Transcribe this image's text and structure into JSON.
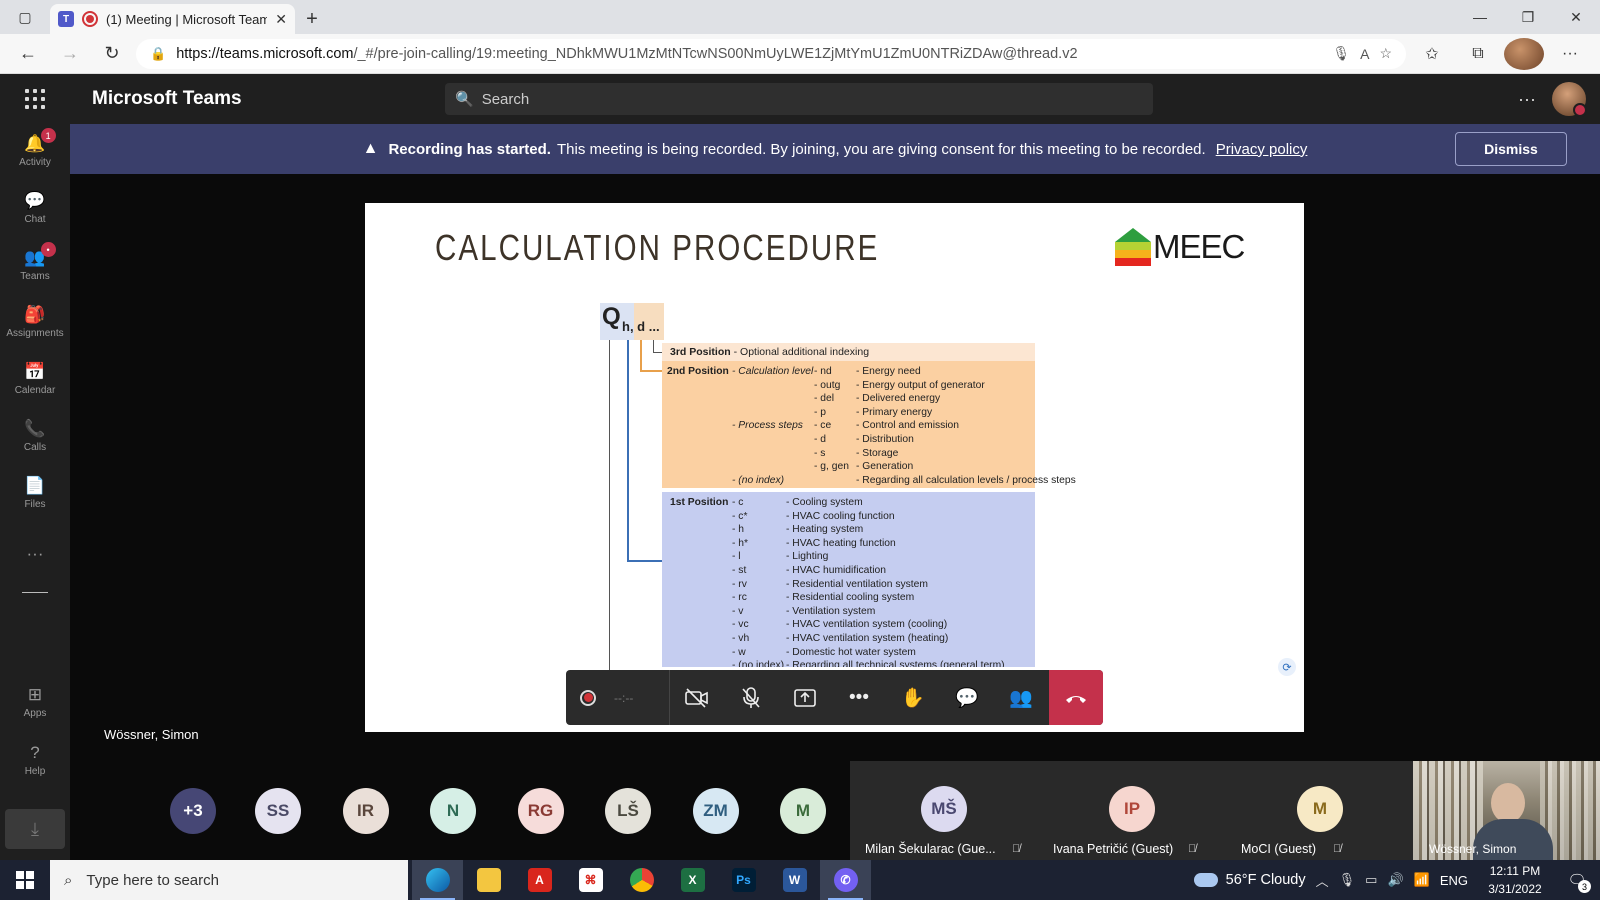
{
  "browser": {
    "tab_title": "(1) Meeting | Microsoft Teams",
    "tab_close": "✕",
    "new_tab": "+",
    "url_host": "https://teams.microsoft.com",
    "url_path": "/_#/pre-join-calling/19:meeting_NDhkMWU1MzMtNTcwNS00NmUyLWE1ZjMtYmU1ZmU0NTRiZDAw@thread.v2",
    "window_controls": [
      "—",
      "❐",
      "✕"
    ]
  },
  "teams": {
    "app_title": "Microsoft Teams",
    "search_placeholder": "Search",
    "more": "···"
  },
  "rail": {
    "items": [
      {
        "label": "Activity",
        "icon": "bell-icon",
        "glyph": "🔔",
        "badge": "1"
      },
      {
        "label": "Chat",
        "icon": "chat-icon",
        "glyph": "💬",
        "badge": ""
      },
      {
        "label": "Teams",
        "icon": "teams-icon",
        "glyph": "👥",
        "badge": "•"
      },
      {
        "label": "Assignments",
        "icon": "assignments-icon",
        "glyph": "🎒",
        "badge": ""
      },
      {
        "label": "Calendar",
        "icon": "calendar-icon",
        "glyph": "📅",
        "badge": ""
      },
      {
        "label": "Calls",
        "icon": "phone-icon",
        "glyph": "📞",
        "badge": ""
      },
      {
        "label": "Files",
        "icon": "file-icon",
        "glyph": "📄",
        "badge": ""
      }
    ],
    "more": "···",
    "apps_label": "Apps",
    "help_label": "Help"
  },
  "banner": {
    "bold": "Recording has started.",
    "text": "This meeting is being recorded. By joining, you are giving consent for this meeting to be recorded.",
    "link": "Privacy policy",
    "dismiss": "Dismiss"
  },
  "slide": {
    "title": "CALCULATION PROCEDURE",
    "logo_text": "MEEC",
    "q_symbol": "Q",
    "q_subscript": "h, d ...",
    "pos3_head": "3rd Position",
    "pos3_text": "- Optional additional indexing",
    "pos2_head": "2nd Position",
    "pos2_rows": [
      {
        "a": "- Calculation level",
        "b": "- nd",
        "c": "- Energy need"
      },
      {
        "a": "",
        "b": "- outg",
        "c": "- Energy output of generator"
      },
      {
        "a": "",
        "b": "- del",
        "c": "- Delivered energy"
      },
      {
        "a": "",
        "b": "- p",
        "c": "- Primary energy"
      },
      {
        "a": "- Process steps",
        "b": "- ce",
        "c": "- Control and emission"
      },
      {
        "a": "",
        "b": "- d",
        "c": "- Distribution"
      },
      {
        "a": "",
        "b": "- s",
        "c": "- Storage"
      },
      {
        "a": "",
        "b": "- g, gen",
        "c": "- Generation"
      },
      {
        "a": "- (no index)",
        "b": "",
        "c": "- Regarding all calculation levels / process steps"
      }
    ],
    "pos1_head": "1st Position",
    "pos1_rows": [
      {
        "b": "- c",
        "c": "- Cooling system"
      },
      {
        "b": "- c*",
        "c": "- HVAC cooling function"
      },
      {
        "b": "- h",
        "c": "- Heating system"
      },
      {
        "b": "- h*",
        "c": "- HVAC heating function"
      },
      {
        "b": "- l",
        "c": "- Lighting"
      },
      {
        "b": "- st",
        "c": "- HVAC humidification"
      },
      {
        "b": "- rv",
        "c": "- Residential ventilation system"
      },
      {
        "b": "- rc",
        "c": "- Residential cooling system"
      },
      {
        "b": "- v",
        "c": "- Ventilation system"
      },
      {
        "b": "- vc",
        "c": "- HVAC ventilation system (cooling)"
      },
      {
        "b": "- vh",
        "c": "- HVAC ventilation system (heating)"
      },
      {
        "b": "- w",
        "c": "- Domestic hot water system"
      },
      {
        "b": "- (no index)",
        "c": "- Regarding all technical systems (general term)"
      }
    ]
  },
  "presenter_name": "Wössner, Simon",
  "controls": {
    "timer": "--:--"
  },
  "participants": {
    "overflow": "+3",
    "avatars": [
      {
        "initials": "SS",
        "bg": "#e5e3f0",
        "fg": "#4a4a66"
      },
      {
        "initials": "IR",
        "bg": "#eadfd8",
        "fg": "#5a463c"
      },
      {
        "initials": "N",
        "bg": "#d6efe6",
        "fg": "#2e6b55"
      },
      {
        "initials": "RG",
        "bg": "#f6dcda",
        "fg": "#8a3a34"
      },
      {
        "initials": "LŠ",
        "bg": "#e4e2da",
        "fg": "#4b4a40"
      },
      {
        "initials": "ZM",
        "bg": "#d7e8f3",
        "fg": "#2f5e80"
      },
      {
        "initials": "M",
        "bg": "#d9ecd9",
        "fg": "#3b6b3b"
      }
    ],
    "tiles": [
      {
        "initials": "MŠ",
        "name": "Milan Šekularac (Gue...",
        "bg": "#dcdaf0",
        "fg": "#4a4870"
      },
      {
        "initials": "IP",
        "name": "Ivana Petričić (Guest)",
        "bg": "#f6d6cf",
        "fg": "#b0473a"
      },
      {
        "initials": "M",
        "name": "MoCI (Guest)",
        "bg": "#f7e9c5",
        "fg": "#8a6a1c"
      }
    ],
    "video_name": "Wössner, Simon"
  },
  "taskbar": {
    "search_placeholder": "Type here to search",
    "weather": "56°F  Cloudy",
    "lang": "ENG",
    "time": "12:11 PM",
    "date": "3/31/2022",
    "notif_count": "3"
  },
  "colors": {
    "banner": "#3a3f6b",
    "hangup": "#c4314b",
    "teams_brand": "#5059c9"
  }
}
